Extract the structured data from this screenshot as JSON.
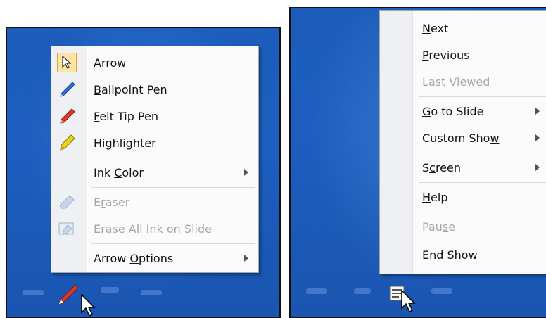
{
  "left_menu": {
    "items": [
      {
        "name": "arrow",
        "label": "Arrow",
        "ul": "A",
        "icon": "arrow-pointer-icon",
        "selected": true,
        "disabled": false
      },
      {
        "name": "ballpoint-pen",
        "label": "Ballpoint Pen",
        "ul": "B",
        "icon": "ballpoint-pen-icon",
        "disabled": false
      },
      {
        "name": "felt-tip-pen",
        "label": "Felt Tip Pen",
        "ul": "F",
        "icon": "felt-tip-pen-icon",
        "disabled": false
      },
      {
        "name": "highlighter",
        "label": "Highlighter",
        "ul": "H",
        "icon": "highlighter-icon",
        "disabled": false
      },
      {
        "name": "ink-color",
        "label": "Ink Color",
        "ul": "C",
        "submenu": true,
        "disabled": false
      },
      {
        "name": "eraser",
        "label": "Eraser",
        "ul": "r",
        "icon": "eraser-icon",
        "disabled": true
      },
      {
        "name": "erase-all-ink",
        "label": "Erase All Ink on Slide",
        "ul": "E",
        "icon": "erase-all-ink-icon",
        "disabled": true
      },
      {
        "name": "arrow-options",
        "label": "Arrow Options",
        "ul": "O",
        "submenu": true,
        "disabled": false
      }
    ]
  },
  "right_menu": {
    "items": [
      {
        "name": "next",
        "label": "Next",
        "ul": "N",
        "disabled": false
      },
      {
        "name": "previous",
        "label": "Previous",
        "ul": "P",
        "disabled": false
      },
      {
        "name": "last-viewed",
        "label": "Last Viewed",
        "ul": "V",
        "disabled": true
      },
      {
        "name": "go-to-slide",
        "label": "Go to Slide",
        "ul": "G",
        "submenu": true,
        "disabled": false
      },
      {
        "name": "custom-show",
        "label": "Custom Show",
        "ul": "w",
        "submenu": true,
        "disabled": false
      },
      {
        "name": "screen",
        "label": "Screen",
        "ul": "c",
        "submenu": true,
        "disabled": false
      },
      {
        "name": "help",
        "label": "Help",
        "ul": "H",
        "disabled": false
      },
      {
        "name": "pause",
        "label": "Pause",
        "ul": "s",
        "disabled": true
      },
      {
        "name": "end-show",
        "label": "End Show",
        "ul": "E",
        "disabled": false
      }
    ]
  },
  "colors": {
    "background": "#1d5ec0",
    "menu": "#fbfbfb",
    "disabled_text": "#a7a7a7",
    "selected_fill": "#fde4a4",
    "selected_border": "#e3a63a",
    "pen_red": "#d83a2a",
    "pen_blue": "#2d6fd0",
    "highlighter_yellow": "#e6d21a"
  },
  "toolbar": {
    "left_active_tool_icon": "felt-tip-pen-icon",
    "right_active_tool_icon": "slide-menu-icon"
  }
}
